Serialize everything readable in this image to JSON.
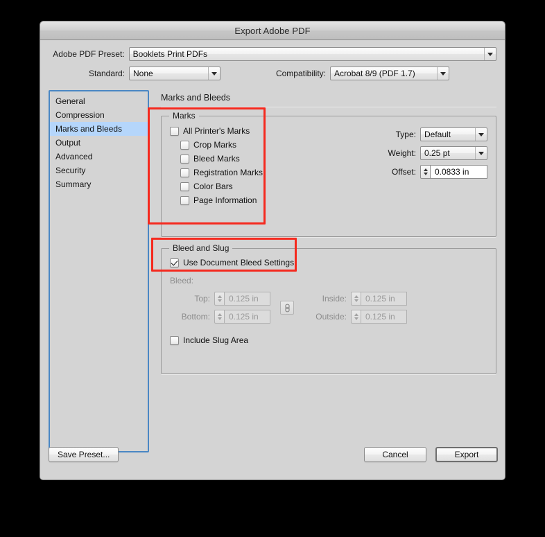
{
  "window": {
    "title": "Export Adobe PDF"
  },
  "preset_row": {
    "label": "Adobe PDF Preset:",
    "value": "Booklets Print PDFs"
  },
  "standard_row": {
    "label": "Standard:",
    "value": "None"
  },
  "compatibility_row": {
    "label": "Compatibility:",
    "value": "Acrobat 8/9 (PDF 1.7)"
  },
  "sidebar": {
    "items": [
      {
        "label": "General",
        "selected": false
      },
      {
        "label": "Compression",
        "selected": false
      },
      {
        "label": "Marks and Bleeds",
        "selected": true
      },
      {
        "label": "Output",
        "selected": false
      },
      {
        "label": "Advanced",
        "selected": false
      },
      {
        "label": "Security",
        "selected": false
      },
      {
        "label": "Summary",
        "selected": false
      }
    ]
  },
  "panel": {
    "title": "Marks and Bleeds"
  },
  "marks": {
    "group_title": "Marks",
    "checkboxes": [
      {
        "label": "All Printer's Marks",
        "checked": false
      },
      {
        "label": "Crop Marks",
        "checked": false
      },
      {
        "label": "Bleed Marks",
        "checked": false
      },
      {
        "label": "Registration Marks",
        "checked": false
      },
      {
        "label": "Color Bars",
        "checked": false
      },
      {
        "label": "Page Information",
        "checked": false
      }
    ],
    "type": {
      "label": "Type:",
      "value": "Default"
    },
    "weight": {
      "label": "Weight:",
      "value": "0.25 pt"
    },
    "offset": {
      "label": "Offset:",
      "value": "0.0833 in"
    }
  },
  "bleed_and_slug": {
    "group_title": "Bleed and Slug",
    "use_document_bleed": {
      "label": "Use Document Bleed Settings",
      "checked": true
    },
    "bleed_label": "Bleed:",
    "fields": {
      "top": {
        "label": "Top:",
        "value": "0.125 in"
      },
      "bottom": {
        "label": "Bottom:",
        "value": "0.125 in"
      },
      "inside": {
        "label": "Inside:",
        "value": "0.125 in"
      },
      "outside": {
        "label": "Outside:",
        "value": "0.125 in"
      }
    },
    "chain_icon": "link-chain-icon",
    "include_slug": {
      "label": "Include Slug Area",
      "checked": false
    }
  },
  "footer": {
    "save_preset": "Save Preset...",
    "cancel": "Cancel",
    "export": "Export"
  },
  "colors": {
    "annotation": "#f5291e",
    "selection": "#b5d6fb",
    "focus_border": "#4a87c4"
  }
}
